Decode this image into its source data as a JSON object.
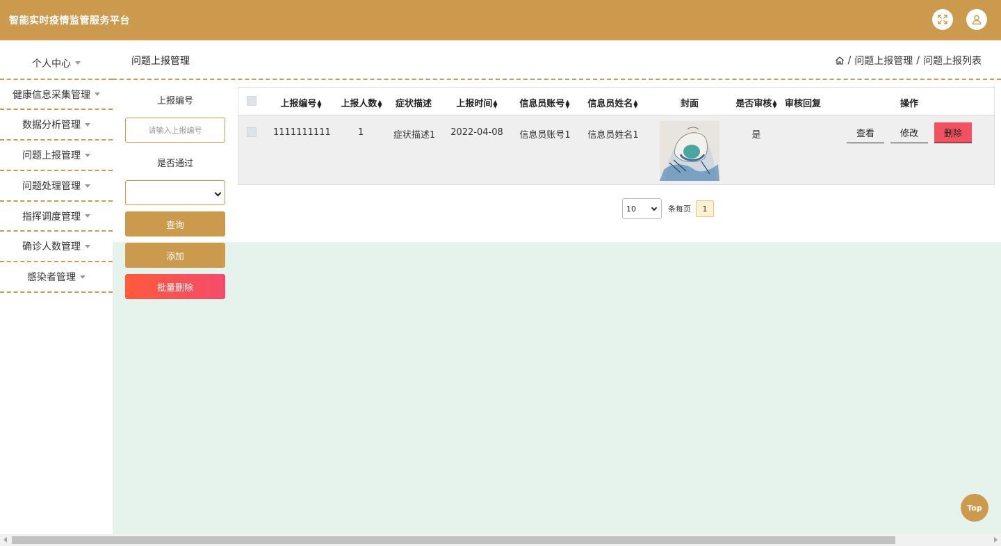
{
  "app": {
    "title": "智能实时疫情监管服务平台"
  },
  "header": {
    "fullscreen_icon": "expand-icon",
    "user_icon": "user-icon"
  },
  "sidebar": {
    "items": [
      {
        "label": "个人中心"
      },
      {
        "label": "健康信息采集管理"
      },
      {
        "label": "数据分析管理"
      },
      {
        "label": "问题上报管理"
      },
      {
        "label": "问题处理管理"
      },
      {
        "label": "指挥调度管理"
      },
      {
        "label": "确诊人数管理"
      },
      {
        "label": "感染者管理"
      }
    ]
  },
  "page": {
    "title": "问题上报管理",
    "breadcrumb": {
      "home_icon": "home-icon",
      "sep": "/",
      "level1": "问题上报管理",
      "level2": "问题上报列表"
    }
  },
  "search": {
    "field1_label": "上报编号",
    "field1_placeholder": "请输入上报编号",
    "field2_label": "是否通过",
    "field2_value": "",
    "query_label": "查询",
    "add_label": "添加",
    "batch_delete_label": "批量删除"
  },
  "table": {
    "headers": [
      "上报编号",
      "上报人数",
      "症状描述",
      "上报时间",
      "信息员账号",
      "信息员姓名",
      "封面",
      "是否审核",
      "审核回复",
      "操作"
    ],
    "rows": [
      {
        "code": "1111111111",
        "count": "1",
        "symptom": "症状描述1",
        "time": "2022-04-08",
        "account": "信息员账号1",
        "name": "信息员姓名1",
        "audited": "是",
        "reply": "",
        "view_label": "查看",
        "edit_label": "修改",
        "delete_label": "删除"
      }
    ]
  },
  "pagination": {
    "page_size": "10",
    "per_page_text": "条每页",
    "current_page": "1"
  },
  "top_button": {
    "label": "Top"
  },
  "colors": {
    "brand": "#cc9a4c",
    "danger": "#f25260",
    "content_bg": "#e6f3ec"
  }
}
